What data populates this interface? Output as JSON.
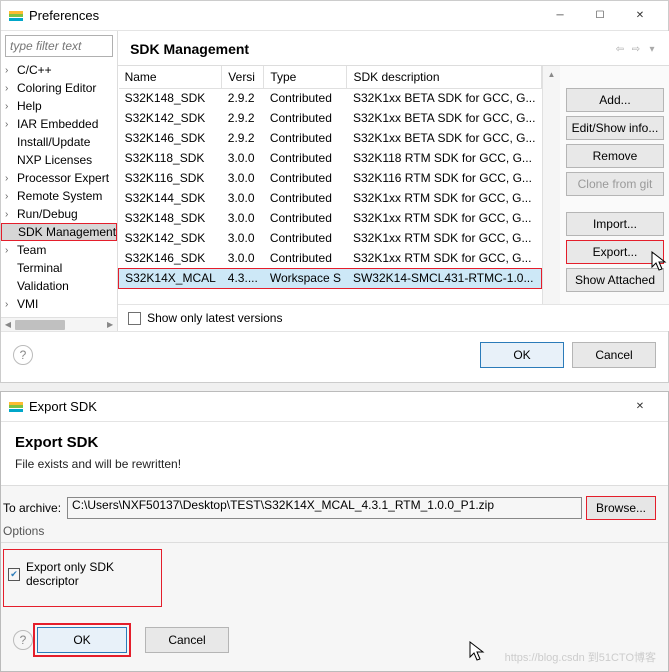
{
  "prefWindow": {
    "title": "Preferences",
    "filterPlaceholder": "type filter text",
    "treeItems": [
      {
        "label": "C/C++",
        "expandable": true
      },
      {
        "label": "Coloring Editor",
        "expandable": true
      },
      {
        "label": "Help",
        "expandable": true
      },
      {
        "label": "IAR Embedded",
        "expandable": true
      },
      {
        "label": "Install/Update",
        "expandable": false
      },
      {
        "label": "NXP Licenses",
        "expandable": false
      },
      {
        "label": "Processor Expert",
        "expandable": true
      },
      {
        "label": "Remote System",
        "expandable": true
      },
      {
        "label": "Run/Debug",
        "expandable": true
      },
      {
        "label": "SDK Management",
        "expandable": false,
        "selected": true
      },
      {
        "label": "Team",
        "expandable": true
      },
      {
        "label": "Terminal",
        "expandable": false
      },
      {
        "label": "Validation",
        "expandable": false
      },
      {
        "label": "VMI",
        "expandable": true
      }
    ],
    "mainTitle": "SDK Management",
    "tableHeaders": [
      "Name",
      "Versi",
      "Type",
      "SDK description"
    ],
    "tableRows": [
      {
        "cells": [
          "S32K148_SDK",
          "2.9.2",
          "Contributed",
          "S32K1xx BETA SDK for GCC, G..."
        ]
      },
      {
        "cells": [
          "S32K142_SDK",
          "2.9.2",
          "Contributed",
          "S32K1xx BETA SDK for GCC, G..."
        ]
      },
      {
        "cells": [
          "S32K146_SDK",
          "2.9.2",
          "Contributed",
          "S32K1xx BETA SDK for GCC, G..."
        ]
      },
      {
        "cells": [
          "S32K118_SDK",
          "3.0.0",
          "Contributed",
          "S32K118 RTM SDK for GCC, G..."
        ]
      },
      {
        "cells": [
          "S32K116_SDK",
          "3.0.0",
          "Contributed",
          "S32K116 RTM SDK for GCC, G..."
        ]
      },
      {
        "cells": [
          "S32K144_SDK",
          "3.0.0",
          "Contributed",
          "S32K1xx RTM SDK for GCC, G..."
        ]
      },
      {
        "cells": [
          "S32K148_SDK",
          "3.0.0",
          "Contributed",
          "S32K1xx RTM SDK for GCC, G..."
        ]
      },
      {
        "cells": [
          "S32K142_SDK",
          "3.0.0",
          "Contributed",
          "S32K1xx RTM SDK for GCC, G..."
        ]
      },
      {
        "cells": [
          "S32K146_SDK",
          "3.0.0",
          "Contributed",
          "S32K1xx RTM SDK for GCC, G..."
        ]
      },
      {
        "cells": [
          "S32K14X_MCAL",
          "4.3....",
          "Workspace S",
          "SW32K14-SMCL431-RTMC-1.0..."
        ],
        "selected": true
      }
    ],
    "buttons": {
      "add": "Add...",
      "editShow": "Edit/Show info...",
      "remove": "Remove",
      "cloneGit": "Clone from git",
      "import": "Import...",
      "export": "Export...",
      "showAttached": "Show Attached"
    },
    "showOnlyLatest": "Show only latest versions",
    "ok": "OK",
    "cancel": "Cancel"
  },
  "exportWindow": {
    "title": "Export SDK",
    "headTitle": "Export SDK",
    "headSub": "File exists and will be rewritten!",
    "archiveLabel": "To archive:",
    "archivePath": "C:\\Users\\NXF50137\\Desktop\\TEST\\S32K14X_MCAL_4.3.1_RTM_1.0.0_P1.zip",
    "browse": "Browse...",
    "optionsLabel": "Options",
    "exportOnlyDescriptor": "Export only SDK descriptor",
    "ok": "OK",
    "cancel": "Cancel",
    "watermark": "https://blog.csdn 到51CTO博客"
  }
}
